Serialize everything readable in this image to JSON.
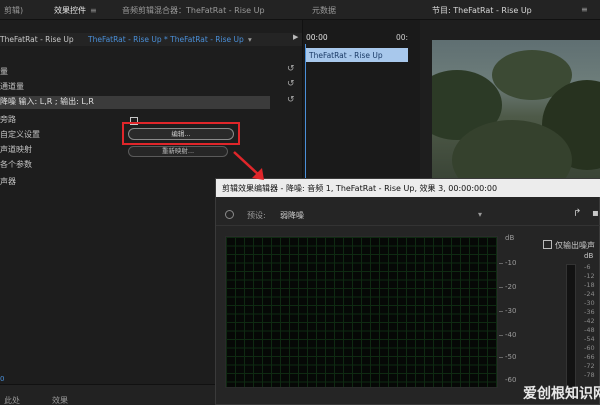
{
  "tabs": [
    {
      "label": "剪辑)",
      "active": false
    },
    {
      "label": "效果控件",
      "active": true
    },
    {
      "label": "音频剪辑混合器：TheFatRat - Rise Up",
      "active": false
    },
    {
      "label": "元数据",
      "active": false
    }
  ],
  "program": {
    "title": "节目: TheFatRat - Rise Up"
  },
  "effect_controls": {
    "sequence_left": "TheFatRat - Rise Up",
    "sequence_right": "TheFatRat - Rise Up * TheFatRat - Rise Up",
    "properties": [
      {
        "label": "量",
        "highlight": false
      },
      {
        "label": "通道量",
        "highlight": false
      },
      {
        "label": "降噪 输入: L,R ; 输出: L,R",
        "highlight": true
      },
      {
        "label": "旁路",
        "highlight": false
      },
      {
        "label": "自定义设置",
        "highlight": false
      },
      {
        "label": "声道映射",
        "highlight": false
      },
      {
        "label": "各个参数",
        "highlight": false
      },
      {
        "label": "声器",
        "highlight": false
      }
    ],
    "edit_button": "编辑...",
    "reset_button": "重新映射...",
    "bottom_zero": "0",
    "bottom_tabs": [
      "此处",
      "效果"
    ]
  },
  "timeline": {
    "tc_start": "00:00",
    "tc_end": "00:",
    "clip_label": "TheFatRat - Rise Up"
  },
  "fx_editor": {
    "title": "剪辑效果编辑器 - 降噪: 音频 1, TheFatRat - Rise Up, 效果 3, 00:00:00:00",
    "preset_label": "预设:",
    "preset_value": "弱降噪",
    "db_labels": [
      "dB",
      "-10",
      "-20",
      "-30",
      "-40",
      "-50",
      "-60"
    ],
    "noise_only_label": "仅输出噪声",
    "meter_labels": [
      "dB",
      "-6",
      "-12",
      "-18",
      "-24",
      "-30",
      "-36",
      "-42",
      "-48",
      "-54",
      "-60",
      "-66",
      "-72",
      "-78"
    ]
  },
  "watermark": {
    "text": "爱创根知识网",
    "sub": ""
  },
  "colors": {
    "accent_blue": "#4a8fd8",
    "highlight_red": "#e0262a",
    "clip_fill": "#a8c8ec"
  }
}
